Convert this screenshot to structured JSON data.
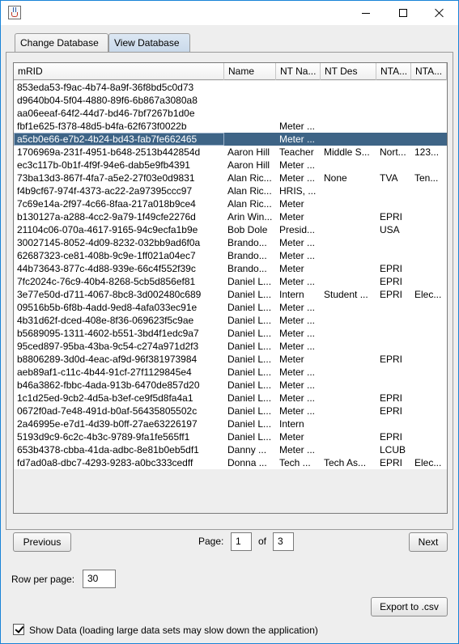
{
  "tabs": [
    "Change Database",
    "View Database"
  ],
  "table": {
    "columns": [
      "mRID",
      "Name",
      "NT Na...",
      "NT Des",
      "NTA...",
      "NTA..."
    ],
    "selected_index": 4,
    "rows": [
      [
        "853eda53-f9ac-4b74-8a9f-36f8bd5c0d73",
        "",
        "",
        "",
        "",
        ""
      ],
      [
        "d9640b04-5f04-4880-89f6-6b867a3080a8",
        "",
        "",
        "",
        "",
        ""
      ],
      [
        "aa06eeaf-64f2-44d7-bd46-7bf7267b1d0e",
        "",
        "",
        "",
        "",
        ""
      ],
      [
        "fbf1e625-f378-48d5-b4fa-62f673f0022b",
        "",
        "Meter ...",
        "",
        "",
        ""
      ],
      [
        "a5cb0e66-e7b2-4b24-bd43-fab7fe662465",
        "",
        "Meter ...",
        "",
        "",
        ""
      ],
      [
        "1706969a-231f-4951-b648-2513b442854d",
        "Aaron Hill",
        "Teacher",
        "Middle S...",
        "Nort...",
        "123..."
      ],
      [
        "ec3c117b-0b1f-4f9f-94e6-dab5e9fb4391",
        "Aaron Hill",
        "Meter ...",
        "",
        "",
        ""
      ],
      [
        "73ba13d3-867f-4fa7-a5e2-27f03e0d9831",
        "Alan Ric...",
        "Meter ...",
        "None",
        "TVA",
        "Ten..."
      ],
      [
        "f4b9cf67-974f-4373-ac22-2a97395ccc97",
        "Alan Ric...",
        "HRIS, ...",
        "",
        "",
        ""
      ],
      [
        "7c69e14a-2f97-4c66-8faa-217a018b9ce4",
        "Alan Ric...",
        "Meter",
        "",
        "",
        ""
      ],
      [
        "b130127a-a288-4cc2-9a79-1f49cfe2276d",
        "Arin Win...",
        "Meter",
        "",
        "EPRI",
        ""
      ],
      [
        "21104c06-070a-4617-9165-94c9ecfa1b9e",
        "Bob Dole",
        "Presid...",
        "",
        "USA",
        ""
      ],
      [
        "30027145-8052-4d09-8232-032bb9ad6f0a",
        "Brando...",
        "Meter ...",
        "",
        "",
        ""
      ],
      [
        "62687323-ce81-408b-9c9e-1ff021a04ec7",
        "Brando...",
        "Meter ...",
        "",
        "",
        ""
      ],
      [
        "44b73643-877c-4d88-939e-66c4f552f39c",
        "Brando...",
        "Meter",
        "",
        "EPRI",
        ""
      ],
      [
        "7fc2024c-76c9-40b4-8268-5cb5d856ef81",
        "Daniel L...",
        "Meter ...",
        "",
        "EPRI",
        ""
      ],
      [
        "3e77e50d-d711-4067-8bc8-3d002480c689",
        "Daniel L...",
        "Intern",
        "Student ...",
        "EPRI",
        "Elec..."
      ],
      [
        "09516b5b-6f8b-4add-9ed8-4afa033ec91e",
        "Daniel L...",
        "Meter ...",
        "",
        "",
        ""
      ],
      [
        "4b31d62f-dced-408e-8f36-069623f5c9ae",
        "Daniel L...",
        "Meter ...",
        "",
        "",
        ""
      ],
      [
        "b5689095-1311-4602-b551-3bd4f1edc9a7",
        "Daniel L...",
        "Meter ...",
        "",
        "",
        ""
      ],
      [
        "95ced897-95ba-43ba-9c54-c274a971d2f3",
        "Daniel L...",
        "Meter ...",
        "",
        "",
        ""
      ],
      [
        "b8806289-3d0d-4eac-af9d-96f381973984",
        "Daniel L...",
        "Meter",
        "",
        "EPRI",
        ""
      ],
      [
        "aeb89af1-c11c-4b44-91cf-27f1129845e4",
        "Daniel L...",
        "Meter ...",
        "",
        "",
        ""
      ],
      [
        "b46a3862-fbbc-4ada-913b-6470de857d20",
        "Daniel L...",
        "Meter ...",
        "",
        "",
        ""
      ],
      [
        "1c1d25ed-9cb2-4d5a-b3ef-ce9f5d8fa4a1",
        "Daniel L...",
        "Meter ...",
        "",
        "EPRI",
        ""
      ],
      [
        "0672f0ad-7e48-491d-b0af-56435805502c",
        "Daniel L...",
        "Meter ...",
        "",
        "EPRI",
        ""
      ],
      [
        "2a46995e-e7d1-4d39-b0ff-27ae63226197",
        "Daniel L...",
        "Intern",
        "",
        "",
        ""
      ],
      [
        "5193d9c9-6c2c-4b3c-9789-9fa1fe565ff1",
        "Daniel L...",
        "Meter",
        "",
        "EPRI",
        ""
      ],
      [
        "653b4378-cbba-41da-adbc-8e81b0eb5df1",
        "Danny ...",
        "Meter ...",
        "",
        "LCUB",
        ""
      ],
      [
        "fd7ad0a8-dbc7-4293-9283-a0bc333cedff",
        "Donna ...",
        "Tech ...",
        "Tech As...",
        "EPRI",
        "Elec..."
      ]
    ]
  },
  "pagination": {
    "previous_label": "Previous",
    "next_label": "Next",
    "page_label": "Page:",
    "current_page": "1",
    "of_label": "of",
    "total_pages": "3"
  },
  "rows_per_page": {
    "label": "Row per page:",
    "value": "30"
  },
  "export_label": "Export to .csv",
  "show_data": {
    "checked": true,
    "label": "Show Data (loading large data sets may slow down the application)"
  },
  "icons": {
    "app": "java-app-icon",
    "minimize": "minimize-icon",
    "maximize": "maximize-icon",
    "close": "close-icon",
    "checkbox": "checkmark-icon"
  },
  "colors": {
    "selected_row": "#3e6486",
    "active_tab": "#c8d8ea",
    "window_border": "#1883d7"
  }
}
